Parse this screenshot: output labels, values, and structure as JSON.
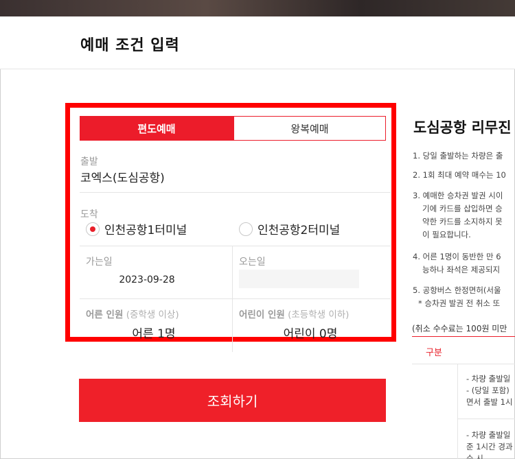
{
  "page": {
    "title": "예매 조건 입력"
  },
  "tabs": {
    "one_way": "편도예매",
    "round_trip": "왕복예매"
  },
  "departure": {
    "label": "출발",
    "value": "코엑스(도심공항)"
  },
  "arrival": {
    "label": "도착",
    "options": [
      "인천공항1터미널",
      "인천공항2터미널"
    ],
    "selected": "인천공항1터미널"
  },
  "dates": {
    "go_label": "가는일",
    "go_value": "2023-09-28",
    "return_label": "오는일",
    "return_value": ""
  },
  "passengers": {
    "adult_label": "어른 인원",
    "adult_sub": "(중학생 이상)",
    "adult_value": "어른 1명",
    "child_label": "어린이 인원",
    "child_sub": "(초등학생 이하)",
    "child_value": "어린이 0명"
  },
  "search_button": "조회하기",
  "notice": {
    "title": "도심공항 리무진",
    "items": [
      [
        "1. 당일 출발하는 차량은 출"
      ],
      [
        "2. 1회 최대 예약 매수는 10"
      ],
      [
        "3. 예매한 승차권 발권 시이",
        "기에 카드를 삽입하면 승",
        "약한 카드를 소지하지 못",
        "이 필요합니다."
      ],
      [
        "4. 어른 1명이 동반한 만 6",
        "능하나 좌석은 제공되지"
      ],
      [
        "5. 공항버스 한정면허(서울",
        "  * 승차권 발권 전 취소 또"
      ]
    ],
    "fee_note": "(취소 수수료는 100원 미만",
    "table_header": "구분",
    "row1": [
      "- 차량 출발일",
      "- (당일 포함)",
      "면서 출발 1시"
    ],
    "row2": [
      "- 차량 출발일",
      "준 1시간 경과",
      "수 시"
    ]
  },
  "colors": {
    "accent": "#ec1c2a",
    "highlight_border": "#ff0000"
  }
}
